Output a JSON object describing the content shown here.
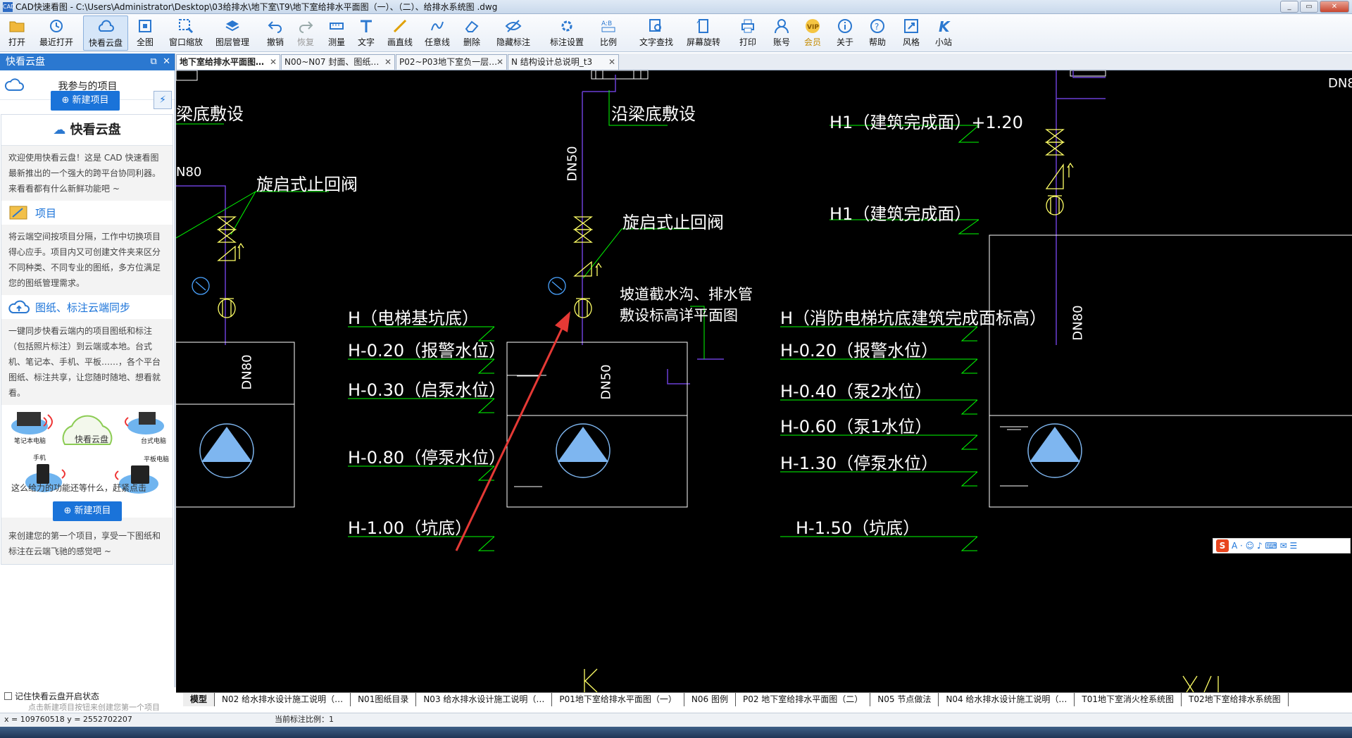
{
  "window": {
    "title": "CAD快速看图 - C:\\Users\\Administrator\\Desktop\\03给排水\\地下室\\T9\\地下室给排水平面图（一）、（二）、给排水系统图 .dwg",
    "app_icon_text": "CAD"
  },
  "toolbar": {
    "items": [
      {
        "label": "打开",
        "icon": "folder-open-icon"
      },
      {
        "label": "最近打开",
        "icon": "history-icon"
      },
      {
        "label": "快看云盘",
        "icon": "cloud-icon"
      },
      {
        "label": "全图",
        "icon": "fullview-icon"
      },
      {
        "label": "窗口缩放",
        "icon": "window-zoom-icon"
      },
      {
        "label": "图层管理",
        "icon": "layers-icon"
      },
      {
        "label": "撤销",
        "icon": "undo-icon"
      },
      {
        "label": "恢复",
        "icon": "redo-icon"
      },
      {
        "label": "测量",
        "icon": "measure-icon"
      },
      {
        "label": "文字",
        "icon": "text-icon"
      },
      {
        "label": "画直线",
        "icon": "line-icon"
      },
      {
        "label": "任意线",
        "icon": "freehand-icon"
      },
      {
        "label": "删除",
        "icon": "eraser-icon"
      },
      {
        "label": "隐藏标注",
        "icon": "eye-hide-icon"
      },
      {
        "label": "标注设置",
        "icon": "annotation-settings-icon"
      },
      {
        "label": "比例",
        "icon": "scale-icon"
      },
      {
        "label": "文字查找",
        "icon": "text-search-icon"
      },
      {
        "label": "屏幕旋转",
        "icon": "rotate-screen-icon"
      },
      {
        "label": "打印",
        "icon": "print-icon"
      },
      {
        "label": "账号",
        "icon": "user-icon"
      },
      {
        "label": "会员",
        "icon": "vip-icon"
      },
      {
        "label": "关于",
        "icon": "info-icon"
      },
      {
        "label": "帮助",
        "icon": "help-icon"
      },
      {
        "label": "风格",
        "icon": "style-icon"
      },
      {
        "label": "小站",
        "icon": "k-station-icon"
      }
    ],
    "active_item": "快看云盘"
  },
  "sidebar": {
    "title": "快看云盘",
    "project_heading": "我参与的项目",
    "new_project_label": "新建项目",
    "sync_icon": "lightning-sync-icon",
    "card": {
      "title": "快看云盘",
      "intro": "欢迎使用快看云盘！这是 CAD 快速看图最新推出的一个强大的跨平台协同利器。来看看都有什么新鲜功能吧 ~",
      "section1_title": "项目",
      "section1_text": "将云端空间按项目分隔，工作中切换项目得心应手。项目内又可创建文件夹来区分不同种类、不同专业的图纸，多方位满足您的图纸管理需求。",
      "section2_title": "图纸、标注云端同步",
      "section2_text": "一键同步快看云端内的项目图纸和标注（包括照片标注）到云端或本地。台式机、笔记本、手机、平板……，各个平台图纸、标注共享，让您随时随地、想看就看。",
      "devices": {
        "laptop": "笔记本电脑",
        "cloud": "快看云盘",
        "desktop": "台式电脑",
        "phone": "手机",
        "tablet": "平板电脑"
      },
      "cta_text": "这么给力的功能还等什么，赶紧点击",
      "cta_button": "新建项目",
      "outro": "来创建您的第一个项目，享受一下图纸和标注在云端飞驰的感觉吧 ~"
    },
    "remember_label": "记住快看云盘开启状态",
    "hint": "点击新建项目按钮来创建您第一个项目"
  },
  "tabs": [
    {
      "label": "地下室给排水平面图…",
      "active": true
    },
    {
      "label": "N00~N07 封面、图纸…",
      "active": false
    },
    {
      "label": "P02~P03地下室负一层…",
      "active": false
    },
    {
      "label": "N 结构设计总说明_t3",
      "active": false
    }
  ],
  "drawing": {
    "labels": {
      "beam_left": "梁底敷设",
      "beam_mid": "沿梁底敷设",
      "dn80_left": "N80",
      "dn_right_top": "DN8",
      "check_valve_left": "旋启式止回阀",
      "check_valve_mid": "旋启式止回阀",
      "dn50_top": "DN50",
      "dn50_bottom": "DN50",
      "dn80_pit_left": "DN80",
      "dn80_pit_right": "DN80",
      "ramp_note_1": "坡道截水沟、排水管",
      "ramp_note_2": "敷设标高详平面图",
      "h1_plus": "H1（建筑完成面）+1.20",
      "h1": "H1（建筑完成面）"
    },
    "levels_mid": [
      "H（电梯基坑底）",
      "H-0.20（报警水位）",
      "H-0.30（启泵水位）",
      "H-0.80（停泵水位）",
      "H-1.00（坑底）"
    ],
    "levels_right": [
      "H（消防电梯坑底建筑完成面标高）",
      "H-0.20（报警水位）",
      "H-0.40（泵2水位）",
      "H-0.60（泵1水位）",
      "H-1.30（停泵水位）",
      "H-1.50（坑底）"
    ],
    "colors": {
      "background": "#000000",
      "text": "#ffffff",
      "leader": "#00ff00",
      "pipe": "#6a3fd6",
      "pump": "#7eb6f0",
      "valve": "#ffff66",
      "arrow": "#e53935"
    }
  },
  "sheet_tabs": [
    {
      "label": "模型",
      "active": true
    },
    {
      "label": "N02 给水排水设计施工说明（…",
      "active": false
    },
    {
      "label": "N01图纸目录",
      "active": false
    },
    {
      "label": "N03 给水排水设计施工说明（…",
      "active": false
    },
    {
      "label": "P01地下室给排水平面图（一）",
      "active": false
    },
    {
      "label": "N06 图例",
      "active": false
    },
    {
      "label": "P02 地下室给排水平面图（二）",
      "active": false
    },
    {
      "label": "N05 节点做法",
      "active": false
    },
    {
      "label": "N04 给水排水设计施工说明（…",
      "active": false
    },
    {
      "label": "T01地下室消火栓系统图",
      "active": false
    },
    {
      "label": "T02地下室给排水系统图",
      "active": false
    }
  ],
  "status": {
    "coords": "x = 109760518  y = 2552702207",
    "scale": "当前标注比例：1"
  },
  "ime": {
    "logo": "S",
    "items": "A · ☺ ♪ ⌨ ✉ ☰"
  }
}
